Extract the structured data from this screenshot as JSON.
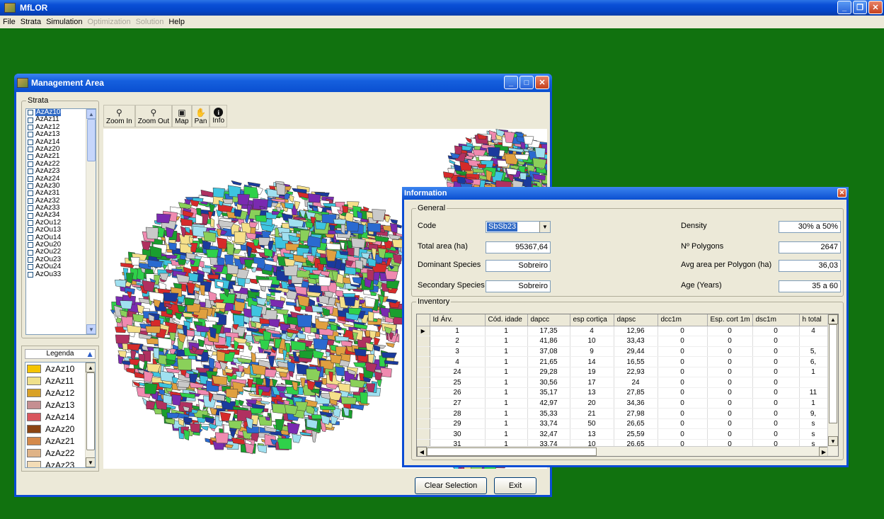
{
  "app": {
    "title": "MfLOR"
  },
  "menu": {
    "items": [
      {
        "label": "File",
        "enabled": true
      },
      {
        "label": "Strata",
        "enabled": true
      },
      {
        "label": "Simulation",
        "enabled": true
      },
      {
        "label": "Optimization",
        "enabled": false
      },
      {
        "label": "Solution",
        "enabled": false
      },
      {
        "label": "Help",
        "enabled": true
      }
    ]
  },
  "management_window": {
    "title": "Management Area",
    "strata_label": "Strata",
    "strata": [
      "AzAz10",
      "AzAz11",
      "AzAz12",
      "AzAz13",
      "AzAz14",
      "AzAz20",
      "AzAz21",
      "AzAz22",
      "AzAz23",
      "AzAz24",
      "AzAz30",
      "AzAz31",
      "AzAz32",
      "AzAz33",
      "AzAz34",
      "AzOu12",
      "AzOu13",
      "AzOu14",
      "AzOu20",
      "AzOu22",
      "AzOu23",
      "AzOu24",
      "AzOu33"
    ],
    "selected_stratum": "AzAz10",
    "legend_title": "Legenda",
    "legend": [
      {
        "label": "AzAz10",
        "color": "#f5c400"
      },
      {
        "label": "AzAz11",
        "color": "#efe08a"
      },
      {
        "label": "AzAz12",
        "color": "#d9a227"
      },
      {
        "label": "AzAz13",
        "color": "#c58f91"
      },
      {
        "label": "AzAz14",
        "color": "#d9565e"
      },
      {
        "label": "AzAz20",
        "color": "#8b4513"
      },
      {
        "label": "AzAz21",
        "color": "#d4894a"
      },
      {
        "label": "AzAz22",
        "color": "#dfb387"
      },
      {
        "label": "AzAz23",
        "color": "#f3dcb6"
      }
    ],
    "tools": [
      {
        "label": "Zoom In",
        "icon": "zoom-in-icon",
        "glyph": "⚲"
      },
      {
        "label": "Zoom Out",
        "icon": "zoom-out-icon",
        "glyph": "⚲"
      },
      {
        "label": "Map",
        "icon": "map-icon",
        "glyph": "▣"
      },
      {
        "label": "Pan",
        "icon": "pan-hand-icon",
        "glyph": "✋"
      },
      {
        "label": "Info",
        "icon": "info-icon",
        "glyph": "i"
      }
    ],
    "clear_selection_label": "Clear Selection",
    "exit_label": "Exit"
  },
  "info_dialog": {
    "title": "Information",
    "general_label": "General",
    "code_label": "Code",
    "code_value": "SbSb23",
    "total_area_label": "Total area (ha)",
    "total_area_value": "95367,64",
    "dominant_label": "Dominant Species",
    "dominant_value": "Sobreiro",
    "secondary_label": "Secondary Species",
    "secondary_value": "Sobreiro",
    "density_label": "Density",
    "density_value": "30% a 50%",
    "npolygons_label": "Nº Polygons",
    "npolygons_value": "2647",
    "avg_area_label": "Avg area per Polygon (ha)",
    "avg_area_value": "36,03",
    "age_label": "Age (Years)",
    "age_value": "35 a 60",
    "inventory_label": "Inventory",
    "columns": [
      "Id Árv.",
      "Cód. idade",
      "dapcc",
      "esp cortiça",
      "dapsc",
      "dcc1m",
      "Esp. cort 1m",
      "dsc1m",
      "h total"
    ],
    "rows": [
      [
        "1",
        "1",
        "17,35",
        "4",
        "12,96",
        "0",
        "0",
        "0",
        "4"
      ],
      [
        "2",
        "1",
        "41,86",
        "10",
        "33,43",
        "0",
        "0",
        "0",
        ""
      ],
      [
        "3",
        "1",
        "37,08",
        "9",
        "29,44",
        "0",
        "0",
        "0",
        "5,"
      ],
      [
        "4",
        "1",
        "21,65",
        "14",
        "16,55",
        "0",
        "0",
        "0",
        "6,"
      ],
      [
        "24",
        "1",
        "29,28",
        "19",
        "22,93",
        "0",
        "0",
        "0",
        "1"
      ],
      [
        "25",
        "1",
        "30,56",
        "17",
        "24",
        "0",
        "0",
        "0",
        ""
      ],
      [
        "26",
        "1",
        "35,17",
        "13",
        "27,85",
        "0",
        "0",
        "0",
        "11"
      ],
      [
        "27",
        "1",
        "42,97",
        "20",
        "34,36",
        "0",
        "0",
        "0",
        "1"
      ],
      [
        "28",
        "1",
        "35,33",
        "21",
        "27,98",
        "0",
        "0",
        "0",
        "9,"
      ],
      [
        "29",
        "1",
        "33,74",
        "50",
        "26,65",
        "0",
        "0",
        "0",
        "s"
      ],
      [
        "30",
        "1",
        "32,47",
        "13",
        "25,59",
        "0",
        "0",
        "0",
        "s"
      ],
      [
        "31",
        "1",
        "33,74",
        "10",
        "26,65",
        "0",
        "0",
        "0",
        "s"
      ]
    ]
  }
}
